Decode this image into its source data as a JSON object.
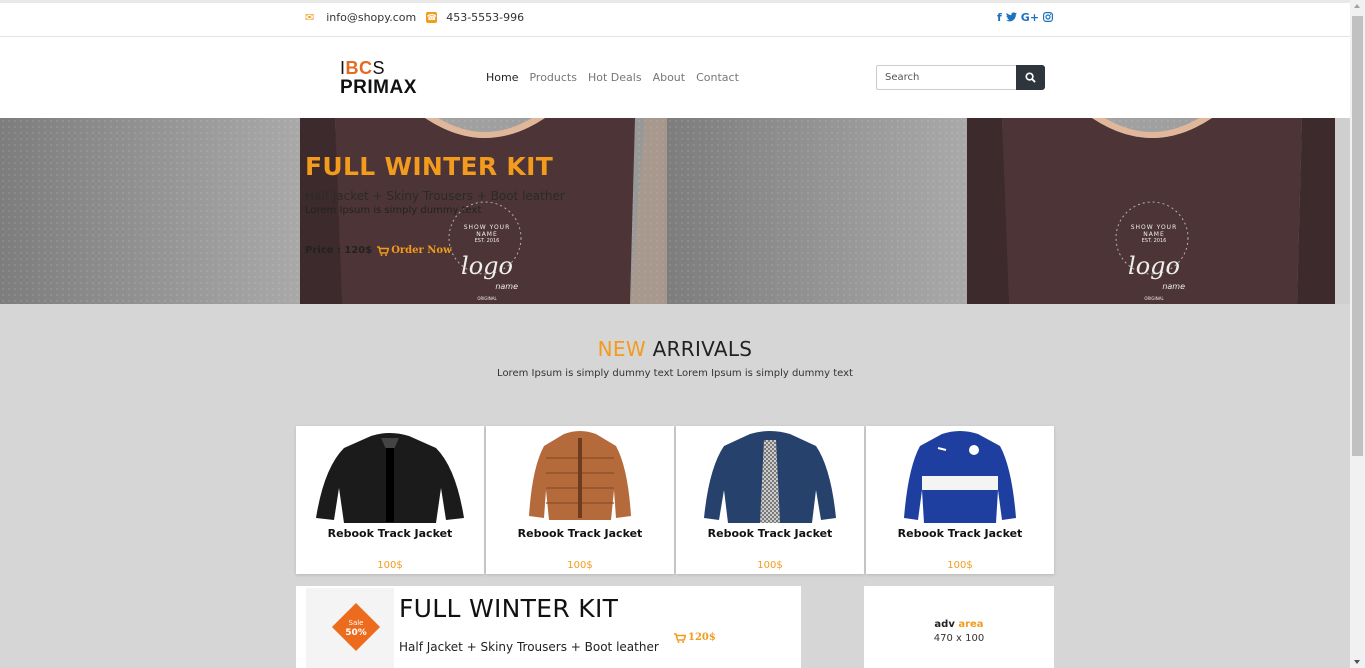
{
  "topbar": {
    "email": "info@shopy.com",
    "phone": "453-5553-996",
    "social": [
      "f",
      "t",
      "G+",
      "ig"
    ],
    "social_icons": [
      "facebook-icon",
      "twitter-icon",
      "google-plus-icon",
      "instagram-icon"
    ]
  },
  "brand": {
    "line1_a": "I",
    "line1_b": "BC",
    "line1_c": "S",
    "line2": "PRIMAX"
  },
  "nav": {
    "items": [
      "Home",
      "Products",
      "Hot Deals",
      "About",
      "Contact"
    ],
    "active": "Home"
  },
  "search": {
    "placeholder": "Search"
  },
  "hero": {
    "title": "FULL WINTER KIT",
    "subtitle": "Half Jacket + Skiny Trousers + Boot leather",
    "desc": "Lorem Ipsum is simply dummy text",
    "price_label": "Price : 120$",
    "order_label": "Order Now",
    "shirt_text_top": "SHOW YOUR NAME",
    "shirt_text_est": "EST. 2016",
    "shirt_logo": "logo",
    "shirt_logo_sub": "name",
    "shirt_text_orig": "ORIGINAL"
  },
  "arrivals": {
    "title_highlight": "NEW",
    "title_rest": " ARRIVALS",
    "subtitle": "Lorem Ipsum is simply dummy text Lorem Ipsum is simply dummy text"
  },
  "products": [
    {
      "name": "Rebook Track Jacket",
      "price": "100$",
      "color": "#1b1b1b"
    },
    {
      "name": "Rebook Track Jacket",
      "price": "100$",
      "color": "#b46a3a"
    },
    {
      "name": "Rebook Track Jacket",
      "price": "100$",
      "color": "#26416c"
    },
    {
      "name": "Rebook Track Jacket",
      "price": "100$",
      "color": "#1f3fa0"
    }
  ],
  "promo": {
    "sale_label": "Sale",
    "sale_value": "50%",
    "title": "FULL WINTER KIT",
    "subtitle": "Half Jacket + Skiny Trousers + Boot leather",
    "price": "120$"
  },
  "adv": {
    "label": "adv",
    "label_highlight": "area",
    "size": "470 x 100"
  },
  "colors": {
    "accent": "#f29b1d",
    "sale": "#ec6b1d",
    "dark": "#2e353d"
  }
}
